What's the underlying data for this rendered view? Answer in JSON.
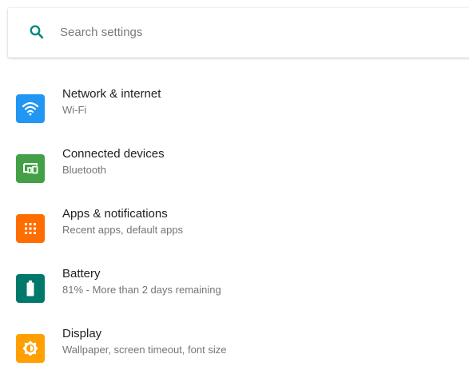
{
  "search": {
    "placeholder": "Search settings",
    "icon": "search-icon",
    "icon_color": "#00897b"
  },
  "items": [
    {
      "title": "Network & internet",
      "subtitle": "Wi-Fi",
      "icon": "wifi-icon",
      "color": "#2196f3"
    },
    {
      "title": "Connected devices",
      "subtitle": "Bluetooth",
      "icon": "devices-icon",
      "color": "#43a047"
    },
    {
      "title": "Apps & notifications",
      "subtitle": "Recent apps, default apps",
      "icon": "apps-icon",
      "color": "#ff6d00"
    },
    {
      "title": "Battery",
      "subtitle": "81% - More than 2 days remaining",
      "icon": "battery-icon",
      "color": "#00796b"
    },
    {
      "title": "Display",
      "subtitle": "Wallpaper, screen timeout, font size",
      "icon": "brightness-icon",
      "color": "#ffa000"
    }
  ]
}
